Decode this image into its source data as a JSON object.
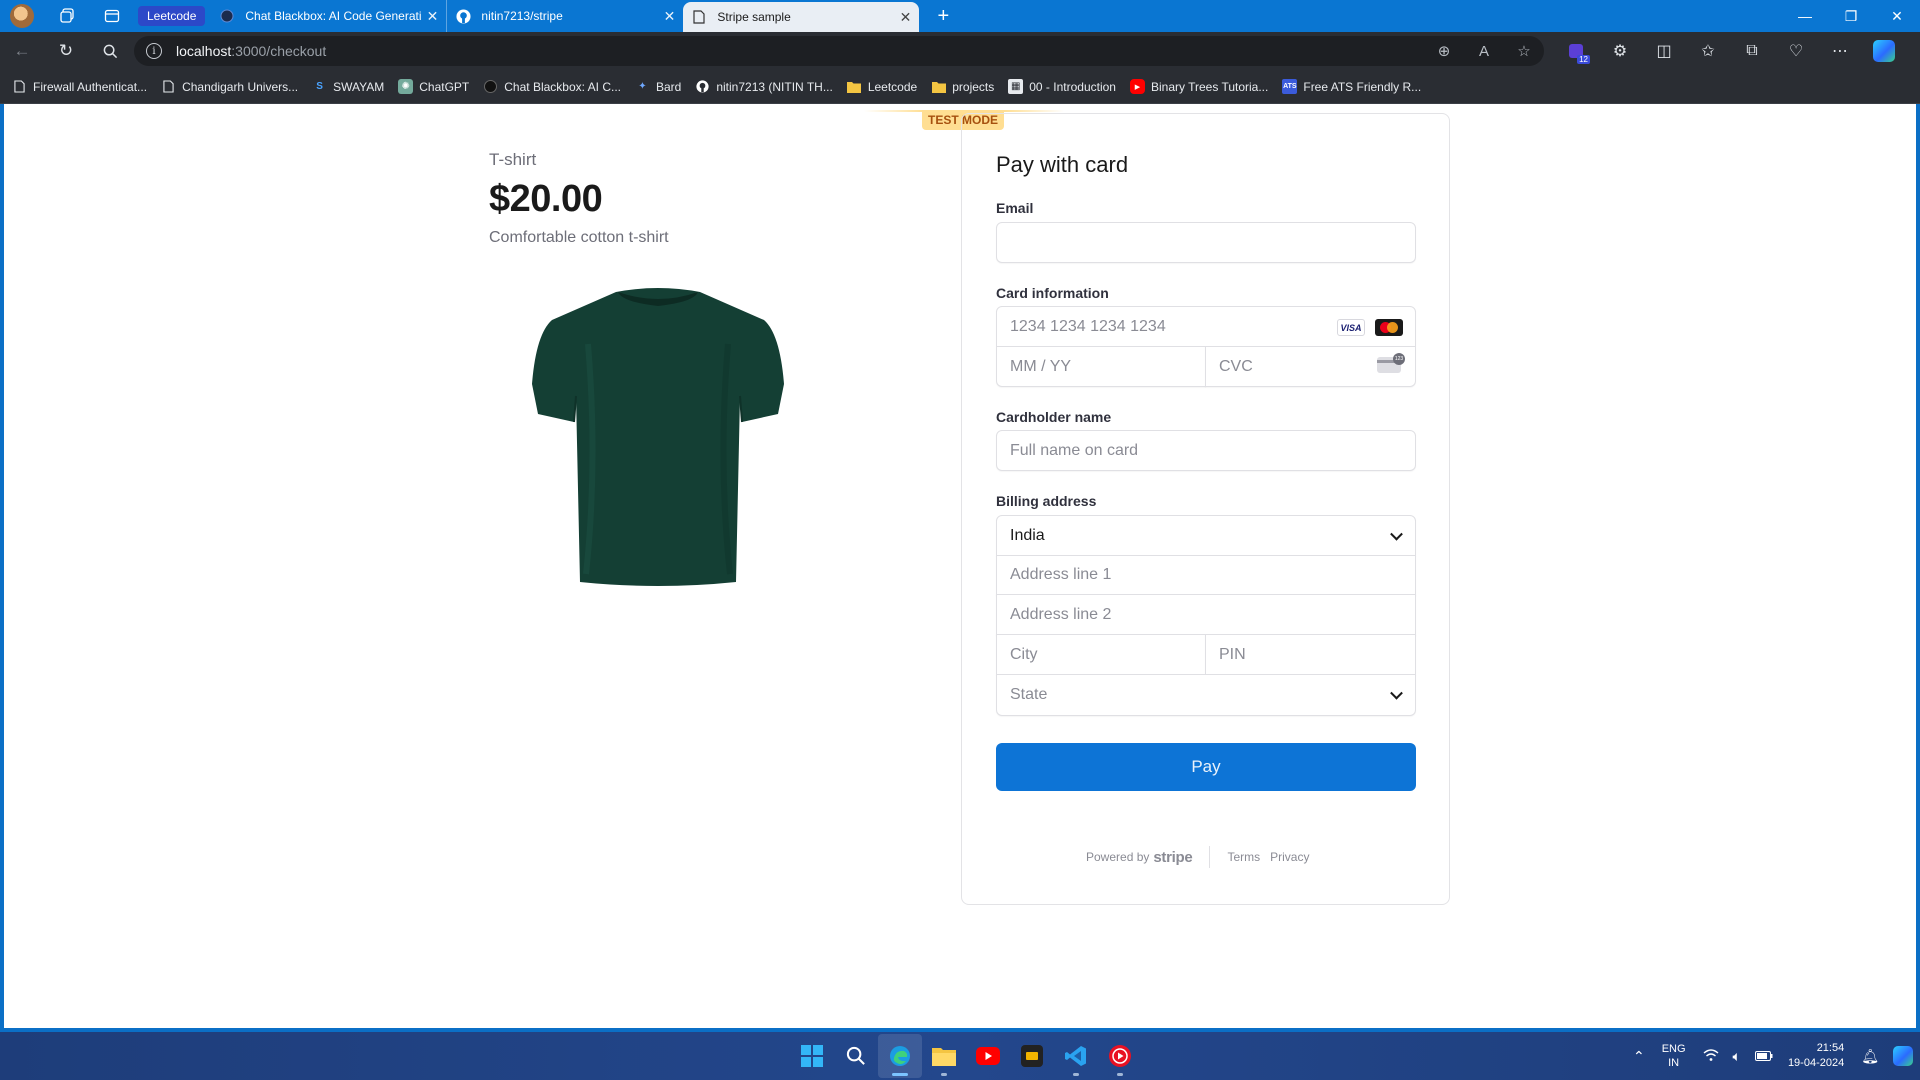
{
  "browser": {
    "tab_group_label": "Leetcode",
    "tabs": [
      {
        "title": "Chat Blackbox: AI Code Generati",
        "icon": "blackbox-icon",
        "active": false
      },
      {
        "title": "nitin7213/stripe",
        "icon": "github-icon",
        "active": false
      },
      {
        "title": "Stripe sample",
        "icon": "page-icon",
        "active": true
      }
    ],
    "url_host": "localhost",
    "url_path": ":3000/checkout",
    "extension_badge": "12"
  },
  "bookmarks": [
    {
      "label": "Firewall Authenticat...",
      "icon": "page-icon"
    },
    {
      "label": "Chandigarh Univers...",
      "icon": "page-icon"
    },
    {
      "label": "SWAYAM",
      "icon": "swayam-icon"
    },
    {
      "label": "ChatGPT",
      "icon": "chatgpt-icon"
    },
    {
      "label": "Chat Blackbox: AI C...",
      "icon": "blackbox-icon"
    },
    {
      "label": "Bard",
      "icon": "bard-icon"
    },
    {
      "label": "nitin7213 (NITIN TH...",
      "icon": "github-icon"
    },
    {
      "label": "Leetcode",
      "icon": "folder-icon"
    },
    {
      "label": "projects",
      "icon": "folder-icon"
    },
    {
      "label": "00 - Introduction",
      "icon": "course-icon"
    },
    {
      "label": "Binary Trees Tutoria...",
      "icon": "youtube-icon"
    },
    {
      "label": "Free ATS Friendly R...",
      "icon": "ats-icon"
    }
  ],
  "product": {
    "name": "T-shirt",
    "price": "$20.00",
    "description": "Comfortable cotton t-shirt",
    "image": "dark-green-tshirt"
  },
  "checkout": {
    "test_mode": "TEST MODE",
    "title": "Pay with card",
    "email_label": "Email",
    "email_value": "",
    "card_label": "Card information",
    "card_number_placeholder": "1234 1234 1234 1234",
    "card_brands": [
      "VISA",
      "Mastercard"
    ],
    "expiry_placeholder": "MM / YY",
    "cvc_placeholder": "CVC",
    "cardholder_label": "Cardholder name",
    "cardholder_placeholder": "Full name on card",
    "billing_label": "Billing address",
    "country_value": "India",
    "address1_placeholder": "Address line 1",
    "address2_placeholder": "Address line 2",
    "city_placeholder": "City",
    "pin_placeholder": "PIN",
    "state_placeholder": "State",
    "pay_label": "Pay",
    "powered_by": "Powered by",
    "powered_brand": "stripe",
    "terms": "Terms",
    "privacy": "Privacy",
    "accent_color": "#0d74d6"
  },
  "taskbar": {
    "language_top": "ENG",
    "language_bottom": "IN",
    "time": "21:54",
    "date": "19-04-2024"
  }
}
